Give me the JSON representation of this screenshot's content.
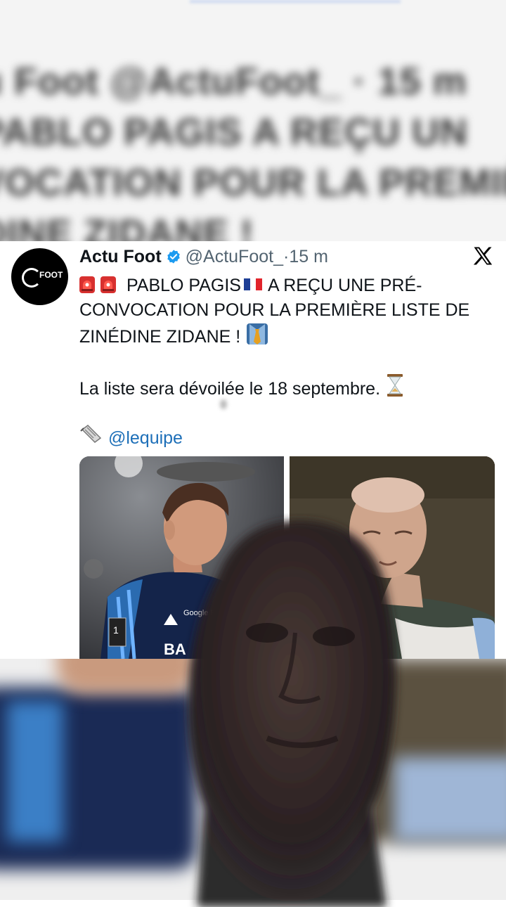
{
  "blurred_header": {
    "line1": "u Foot  @ActuFoot_ · 15 m",
    "line2": "PABLO PAGIS  A REÇU UN",
    "line3": "VOCATION POUR LA PREMIÈ",
    "line4": "DINE ZIDANE !"
  },
  "tweet": {
    "author_name": "Actu Foot",
    "handle": "@ActuFoot_",
    "separator": " · ",
    "time": "15 m",
    "avatar_text": "FOOT",
    "line1": "PABLO PAGIS",
    "line1b": "A REÇU UNE PRÉ-",
    "line2": "CONVOCATION POUR LA PREMIÈRE LISTE DE",
    "line3": "ZINÉDINE ZIDANE !",
    "line4": "La liste sera dévoilée le 18 septembre.",
    "mention": "@lequipe",
    "player_shirt_text": "BA",
    "sponsor_text": "Google Pixel",
    "ligue_badge": "1"
  },
  "icons": {
    "verified": "verified-badge-icon",
    "x_logo": "x-logo-icon",
    "siren": "police-siren-emoji",
    "flag": "france-flag-emoji",
    "tie": "necktie-shirt-emoji",
    "hourglass": "hourglass-emoji",
    "newspaper": "rolled-newspaper-emoji"
  },
  "colors": {
    "verified": "#1d9bf0",
    "mention": "#1d6fb8",
    "handle": "#536471"
  }
}
